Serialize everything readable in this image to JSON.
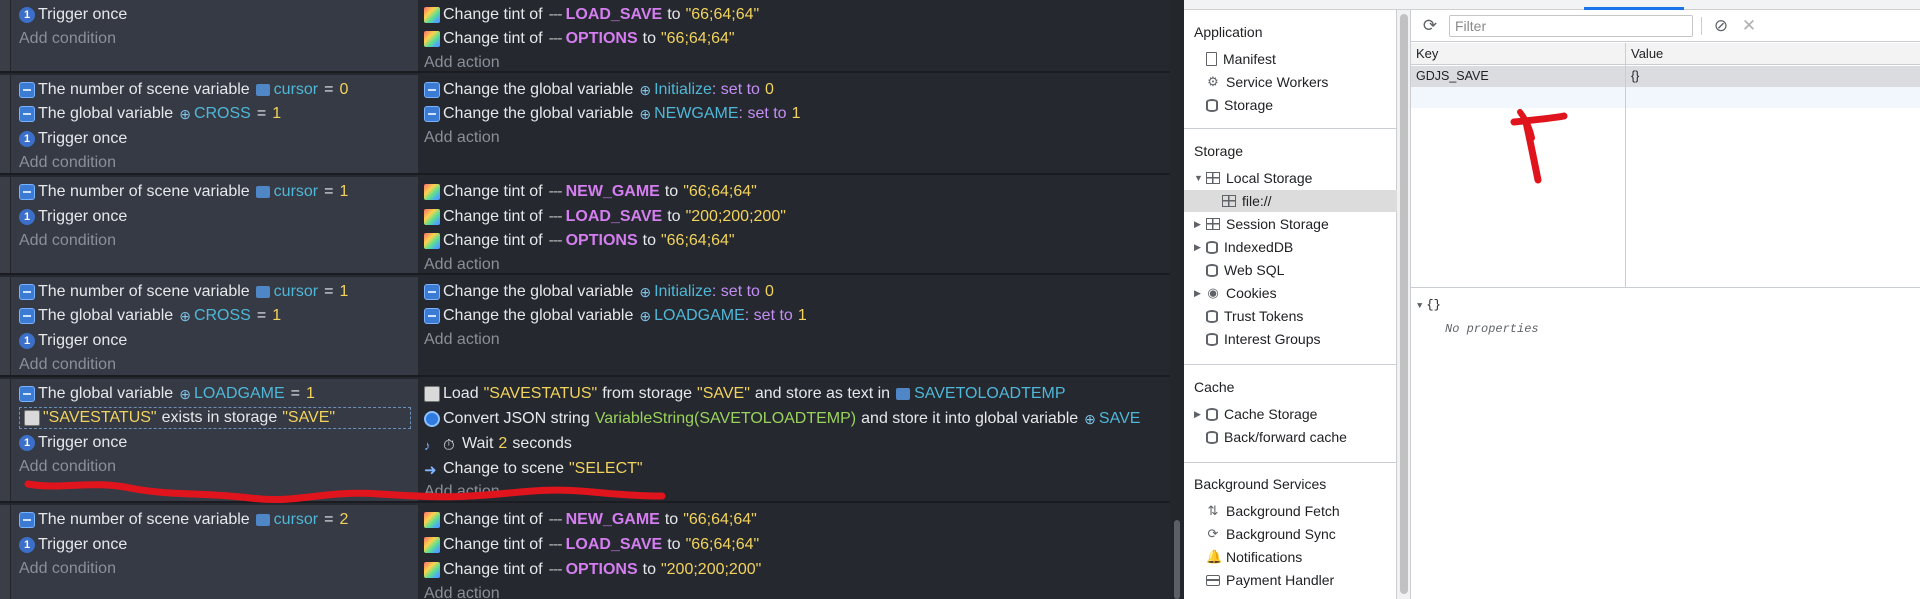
{
  "event_sheet": {
    "events": [
      {
        "conditions": [
          {
            "icon": "trigger-icon",
            "text": "Trigger once"
          },
          {
            "add": "Add condition"
          }
        ],
        "actions": [
          {
            "icon": "tint-icon",
            "pre": "Change tint of",
            "object": "LOAD_SAVE",
            "mid": "to",
            "value": "\"66;64;64\""
          },
          {
            "icon": "tint-icon",
            "pre": "Change tint of",
            "object": "OPTIONS",
            "mid": "to",
            "value": "\"66;64;64\""
          },
          {
            "add": "Add action"
          }
        ]
      },
      {
        "conditions": [
          {
            "pre": "The number of scene variable",
            "var": "cursor",
            "op": "=",
            "value": "0"
          },
          {
            "pre": "The global variable",
            "var": "CROSS",
            "op": "=",
            "value": "1"
          },
          {
            "pre": "Trigger once"
          },
          {
            "add": "Add condition"
          }
        ],
        "actions": [
          {
            "pre": "Change the global variable",
            "var": "Initialize",
            "kw": ": set to",
            "value": "0"
          },
          {
            "pre": "Change the global variable",
            "var": "NEWGAME",
            "kw": ": set to",
            "value": "1"
          },
          {
            "add": "Add action"
          }
        ]
      },
      {
        "conditions": [
          {
            "pre": "The number of scene variable",
            "var": "cursor",
            "op": "=",
            "value": "1"
          },
          {
            "pre": "Trigger once"
          },
          {
            "add": "Add condition"
          }
        ],
        "actions": [
          {
            "pre": "Change tint of",
            "object": "NEW_GAME",
            "mid": "to",
            "value": "\"66;64;64\""
          },
          {
            "pre": "Change tint of",
            "object": "LOAD_SAVE",
            "mid": "to",
            "value": "\"200;200;200\""
          },
          {
            "pre": "Change tint of",
            "object": "OPTIONS",
            "mid": "to",
            "value": "\"66;64;64\""
          },
          {
            "add": "Add action"
          }
        ]
      },
      {
        "conditions": [
          {
            "pre": "The number of scene variable",
            "var": "cursor",
            "op": "=",
            "value": "1"
          },
          {
            "pre": "The global variable",
            "var": "CROSS",
            "op": "=",
            "value": "1"
          },
          {
            "pre": "Trigger once"
          },
          {
            "add": "Add condition"
          }
        ],
        "actions": [
          {
            "pre": "Change the global variable",
            "var": "Initialize",
            "kw": ": set to",
            "value": "0"
          },
          {
            "pre": "Change the global variable",
            "var": "LOADGAME",
            "kw": ": set to",
            "value": "1"
          },
          {
            "add": "Add action"
          }
        ]
      },
      {
        "conditions": [
          {
            "pre": "The global variable",
            "var": "LOADGAME",
            "op": "=",
            "value": "1"
          },
          {
            "str1": "\"SAVESTATUS\"",
            "pre": "exists in storage",
            "str2": "\"SAVE\""
          },
          {
            "pre": "Trigger once"
          },
          {
            "add": "Add condition"
          }
        ],
        "actions": [
          {
            "pre": "Load",
            "str1": "\"SAVESTATUS\"",
            "mid": "from storage",
            "str2": "\"SAVE\"",
            "mid2": "and store as text in",
            "var": "SAVETOLOADTEMP"
          },
          {
            "pre": "Convert JSON string",
            "expr": "VariableString(SAVETOLOADTEMP)",
            "mid": "and store it into global variable",
            "var": "SAVE"
          },
          {
            "pre": "Wait",
            "value": "2",
            "post": "seconds"
          },
          {
            "pre": "Change to scene",
            "str1": "\"SELECT\""
          },
          {
            "add": "Add action"
          }
        ]
      },
      {
        "conditions": [
          {
            "pre": "The number of scene variable",
            "var": "cursor",
            "op": "=",
            "value": "2"
          },
          {
            "pre": "Trigger once"
          },
          {
            "add": "Add condition"
          }
        ],
        "actions": [
          {
            "pre": "Change tint of",
            "object": "NEW_GAME",
            "mid": "to",
            "value": "\"66;64;64\""
          },
          {
            "pre": "Change tint of",
            "object": "LOAD_SAVE",
            "mid": "to",
            "value": "\"66;64;64\""
          },
          {
            "pre": "Change tint of",
            "object": "OPTIONS",
            "mid": "to",
            "value": "\"200;200;200\""
          },
          {
            "add": "Add action"
          }
        ]
      }
    ]
  },
  "devtools": {
    "sections": {
      "application": {
        "title": "Application",
        "items": [
          "Manifest",
          "Service Workers",
          "Storage"
        ]
      },
      "storage": {
        "title": "Storage",
        "items": [
          "Local Storage",
          "file://",
          "Session Storage",
          "IndexedDB",
          "Web SQL",
          "Cookies",
          "Trust Tokens",
          "Interest Groups"
        ]
      },
      "cache": {
        "title": "Cache",
        "items": [
          "Cache Storage",
          "Back/forward cache"
        ]
      },
      "background": {
        "title": "Background Services",
        "items": [
          "Background Fetch",
          "Background Sync",
          "Notifications",
          "Payment Handler"
        ]
      }
    },
    "toolbar": {
      "filter_placeholder": "Filter"
    },
    "table": {
      "headers": [
        "Key",
        "Value"
      ],
      "rows": [
        {
          "key": "GDJS_SAVE",
          "value": "{}"
        }
      ]
    },
    "preview": {
      "root": "{}",
      "empty": "No properties"
    }
  },
  "colors": {
    "annotation": "#e0141c",
    "accent": "#1a73e8"
  }
}
